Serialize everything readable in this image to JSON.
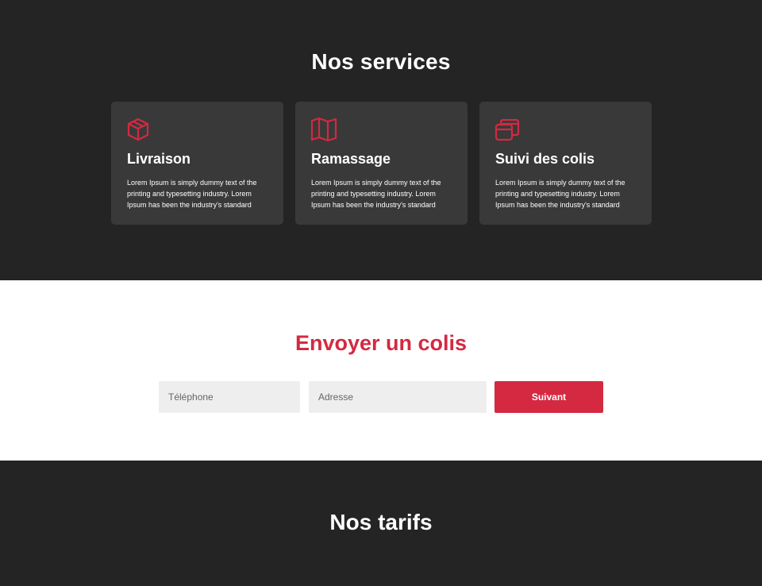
{
  "colors": {
    "accent": "#d42941",
    "dark_bg": "#242424",
    "card_bg": "#393939",
    "field_bg": "#eeeeee"
  },
  "services": {
    "title": "Nos services",
    "cards": [
      {
        "icon": "box-icon",
        "title": "Livraison",
        "text": "Lorem Ipsum is simply dummy text of the printing and typesetting industry. Lorem Ipsum has been the industry's standard"
      },
      {
        "icon": "map-icon",
        "title": "Ramassage",
        "text": "Lorem Ipsum is simply dummy text of the printing and typesetting industry. Lorem Ipsum has been the industry's standard"
      },
      {
        "icon": "stacked-boxes-icon",
        "title": "Suivi des colis",
        "text": "Lorem Ipsum is simply dummy text of the printing and typesetting industry. Lorem Ipsum has been the industry's standard"
      }
    ]
  },
  "send": {
    "title": "Envoyer un colis",
    "phone_placeholder": "Téléphone",
    "address_placeholder": "Adresse",
    "submit_label": "Suivant"
  },
  "tarifs": {
    "title": "Nos tarifs"
  }
}
